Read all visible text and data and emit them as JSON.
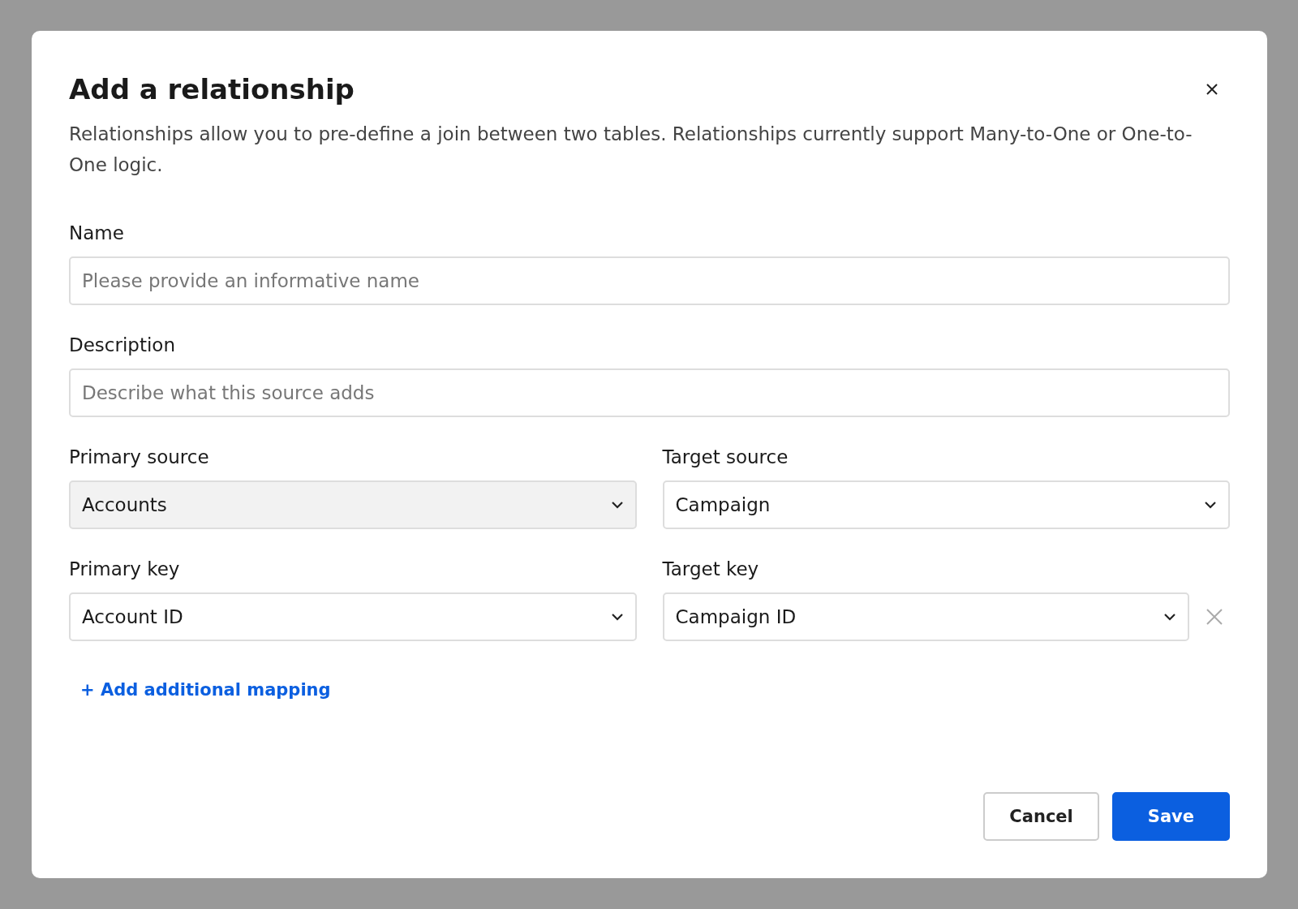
{
  "dialog": {
    "title": "Add a relationship",
    "description": "Relationships allow you to pre-define a join between two tables. Relationships currently support Many-to-One or One-to-One logic."
  },
  "fields": [
    {
      "label": "Name",
      "placeholder": "Please provide an informative name"
    },
    {
      "label": "Description",
      "placeholder": "Describe what this source adds"
    }
  ],
  "sources": [
    {
      "label": "Primary source",
      "value": "Accounts",
      "disabled": true
    },
    {
      "label": "Target source",
      "value": "Campaign",
      "disabled": false
    }
  ],
  "keys": [
    {
      "label": "Primary key",
      "value": "Account ID",
      "removable": false
    },
    {
      "label": "Target key",
      "value": "Campaign ID",
      "removable": true
    }
  ],
  "add_mapping": "+ Add additional mapping",
  "buttons": [
    {
      "label": "Cancel",
      "kind": "secondary"
    },
    {
      "label": "Save",
      "kind": "primary"
    }
  ]
}
